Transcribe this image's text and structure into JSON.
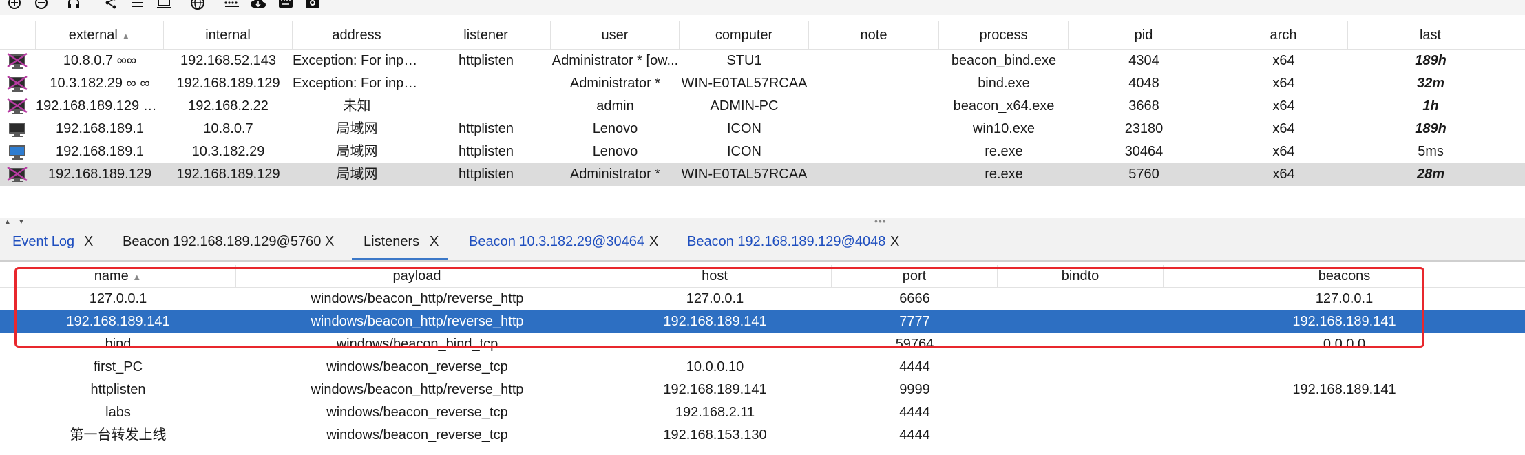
{
  "toolbar": {
    "icons": [
      "add-circle-icon",
      "remove-circle-icon",
      "headphones-icon",
      "share-icon",
      "list-icon",
      "monitor-icon",
      "globe-icon",
      "keyboard-icon",
      "cloud-download-icon",
      "keyboard-small-icon",
      "camera-icon"
    ]
  },
  "beacons": {
    "columns": [
      "external",
      "internal",
      "address",
      "listener",
      "user",
      "computer",
      "note",
      "process",
      "pid",
      "arch",
      "last"
    ],
    "sort_arrow": "▲",
    "rows": [
      {
        "external": "10.8.0.7 ∞∞",
        "internal": "192.168.52.143",
        "address": "Exception: For inpu...",
        "listener": "httplisten",
        "user": "Administrator * [ow...",
        "computer": "STU1",
        "note": "",
        "process": "beacon_bind.exe",
        "pid": "4304",
        "arch": "x64",
        "last": "189h",
        "last_bold": true
      },
      {
        "external": "10.3.182.29 ∞ ∞",
        "internal": "192.168.189.129",
        "address": "Exception: For inpu...",
        "listener": "",
        "user": "Administrator *",
        "computer": "WIN-E0TAL57RCAA",
        "note": "",
        "process": "bind.exe",
        "pid": "4048",
        "arch": "x64",
        "last": "32m",
        "last_bold": true
      },
      {
        "external": "192.168.189.129 ∞...",
        "internal": "192.168.2.22",
        "address": "未知",
        "listener": "",
        "user": "admin",
        "computer": "ADMIN-PC",
        "note": "",
        "process": "beacon_x64.exe",
        "pid": "3668",
        "arch": "x64",
        "last": "1h",
        "last_bold": true
      },
      {
        "external": "192.168.189.1",
        "internal": "10.8.0.7",
        "address": "局域网",
        "listener": "httplisten",
        "user": "Lenovo",
        "computer": "ICON",
        "note": "",
        "process": "win10.exe",
        "pid": "23180",
        "arch": "x64",
        "last": "189h",
        "last_bold": true
      },
      {
        "external": "192.168.189.1",
        "internal": "10.3.182.29",
        "address": "局域网",
        "listener": "httplisten",
        "user": "Lenovo",
        "computer": "ICON",
        "note": "",
        "process": "re.exe",
        "pid": "30464",
        "arch": "x64",
        "last": "5ms",
        "last_bold": false
      },
      {
        "external": "192.168.189.129",
        "internal": "192.168.189.129",
        "address": "局域网",
        "listener": "httplisten",
        "user": "Administrator *",
        "computer": "WIN-E0TAL57RCAA",
        "note": "",
        "process": "re.exe",
        "pid": "5760",
        "arch": "x64",
        "last": "28m",
        "last_bold": true
      }
    ]
  },
  "tabs": [
    {
      "label": "Event Log",
      "color": "#1f4fbf",
      "close": "X"
    },
    {
      "label": "Beacon 192.168.189.129@5760",
      "color": "#1a1a1a",
      "close": "X"
    },
    {
      "label": "Listeners",
      "color": "#1a1a1a",
      "close": "X",
      "active": true
    },
    {
      "label": "Beacon 10.3.182.29@30464",
      "color": "#1f4fbf",
      "close": "X"
    },
    {
      "label": "Beacon 192.168.189.129@4048",
      "color": "#1f4fbf",
      "close": "X"
    }
  ],
  "listeners": {
    "columns": [
      "name",
      "payload",
      "host",
      "port",
      "bindto",
      "beacons"
    ],
    "rows": [
      {
        "name": "127.0.0.1",
        "payload": "windows/beacon_http/reverse_http",
        "host": "127.0.0.1",
        "port": "6666",
        "bindto": "",
        "beacons": "127.0.0.1"
      },
      {
        "name": "192.168.189.141",
        "payload": "windows/beacon_http/reverse_http",
        "host": "192.168.189.141",
        "port": "7777",
        "bindto": "",
        "beacons": "192.168.189.141"
      },
      {
        "name": "bind",
        "payload": "windows/beacon_bind_tcp",
        "host": "",
        "port": "59764",
        "bindto": "",
        "beacons": "0.0.0.0"
      },
      {
        "name": "first_PC",
        "payload": "windows/beacon_reverse_tcp",
        "host": "10.0.0.10",
        "port": "4444",
        "bindto": "",
        "beacons": ""
      },
      {
        "name": "httplisten",
        "payload": "windows/beacon_http/reverse_http",
        "host": "192.168.189.141",
        "port": "9999",
        "bindto": "",
        "beacons": "192.168.189.141"
      },
      {
        "name": "labs",
        "payload": "windows/beacon_reverse_tcp",
        "host": "192.168.2.11",
        "port": "4444",
        "bindto": "",
        "beacons": ""
      },
      {
        "name": "第一台转发上线",
        "payload": "windows/beacon_reverse_tcp",
        "host": "192.168.153.130",
        "port": "4444",
        "bindto": "",
        "beacons": ""
      }
    ]
  },
  "colors": {
    "selection": "#2d6fc2",
    "highlight_box": "#e8272d",
    "link_tab": "#1f4fbf"
  }
}
